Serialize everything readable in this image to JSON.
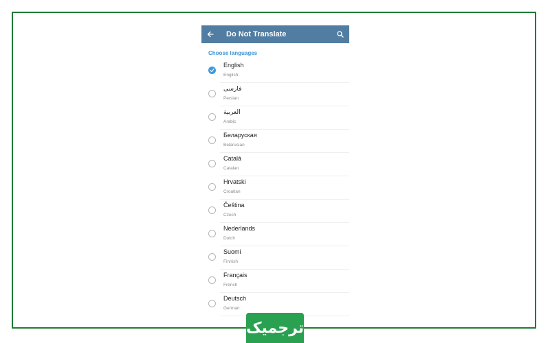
{
  "header": {
    "title": "Do Not Translate",
    "back_icon": "arrow-left-icon",
    "search_icon": "search-icon"
  },
  "section_label": "Choose languages",
  "languages": [
    {
      "name": "English",
      "sub": "English",
      "selected": true
    },
    {
      "name": "فارسی",
      "sub": "Persian",
      "selected": false
    },
    {
      "name": "العربية",
      "sub": "Arabic",
      "selected": false
    },
    {
      "name": "Беларуская",
      "sub": "Belarusian",
      "selected": false
    },
    {
      "name": "Català",
      "sub": "Catalan",
      "selected": false
    },
    {
      "name": "Hrvatski",
      "sub": "Croatian",
      "selected": false
    },
    {
      "name": "Čeština",
      "sub": "Czech",
      "selected": false
    },
    {
      "name": "Nederlands",
      "sub": "Dutch",
      "selected": false
    },
    {
      "name": "Suomi",
      "sub": "Finnish",
      "selected": false
    },
    {
      "name": "Français",
      "sub": "French",
      "selected": false
    },
    {
      "name": "Deutsch",
      "sub": "German",
      "selected": false
    }
  ],
  "watermark": "ترجمیک",
  "colors": {
    "appbar": "#517da2",
    "accent": "#3a95d5",
    "frame": "#1e7b34",
    "logo": "#2aa150"
  }
}
